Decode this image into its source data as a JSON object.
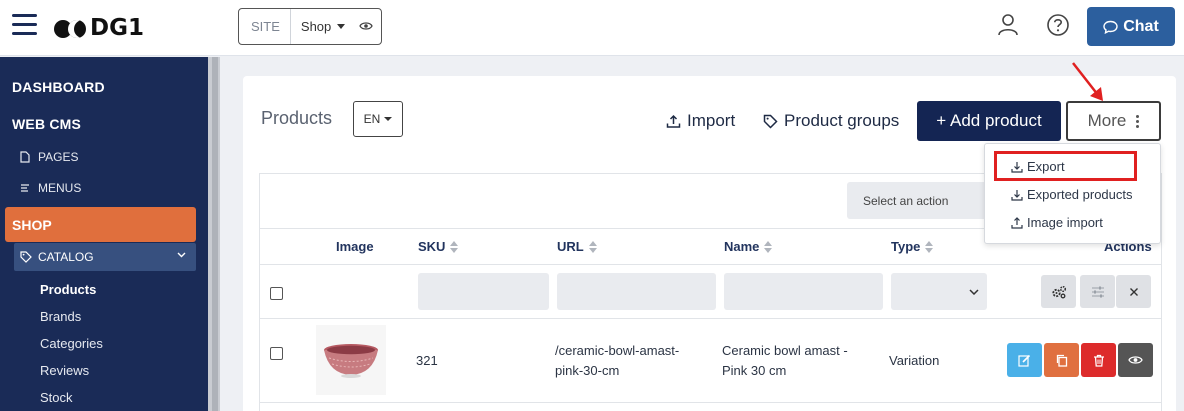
{
  "header": {
    "logo_text": "DG1",
    "site_switch": {
      "label": "SITE",
      "value": "Shop"
    },
    "chat_label": "Chat"
  },
  "sidebar": {
    "dashboard": "DASHBOARD",
    "web_cms": "WEB CMS",
    "pages": "PAGES",
    "menus": "MENUS",
    "shop": "SHOP",
    "catalog": "CATALOG",
    "items": [
      "Products",
      "Brands",
      "Categories",
      "Reviews",
      "Stock"
    ],
    "active_item": "Products"
  },
  "main": {
    "title": "Products",
    "language": "EN",
    "import_label": "Import",
    "product_groups_label": "Product groups",
    "add_product_label": "+ Add product",
    "more_label": "More",
    "more_menu": [
      "Export",
      "Exported products",
      "Image import"
    ],
    "highlighted_menu_item": "Export",
    "action_select_placeholder": "Select an action"
  },
  "table": {
    "columns": [
      "Image",
      "SKU",
      "URL",
      "Name",
      "Type",
      "Actions"
    ],
    "rows": [
      {
        "sku": "321",
        "url_line1": "/ceramic-bowl-amast-",
        "url_line2": "pink-30-cm",
        "name_line1": "Ceramic bowl amast -",
        "name_line2": "Pink 30 cm",
        "type": "Variation"
      }
    ]
  },
  "colors": {
    "sidebar_bg": "#1a2b57",
    "shop_accent": "#e06f3d",
    "primary_button": "#142553",
    "chat_button": "#2c5f9e",
    "annotation_red": "#e02020",
    "edit_btn": "#4ab0e8",
    "copy_btn": "#e07040",
    "delete_btn": "#dd2b2b",
    "view_btn": "#555555"
  }
}
